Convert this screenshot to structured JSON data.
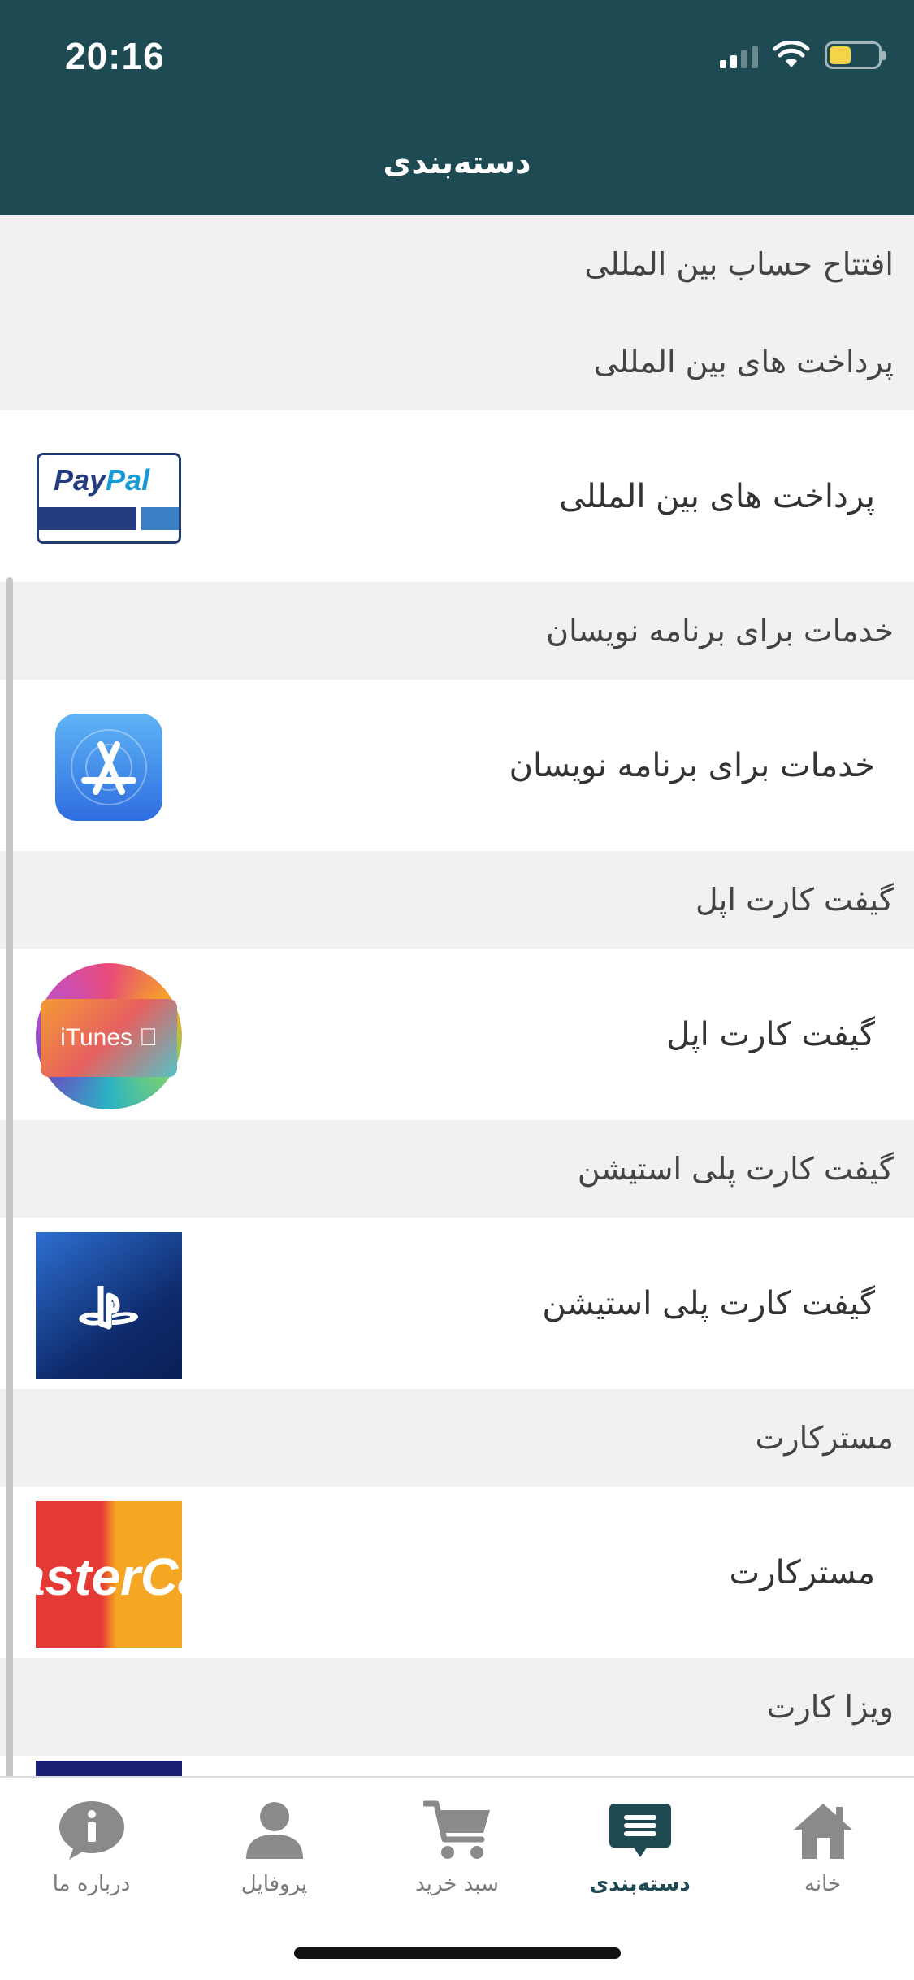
{
  "status_bar": {
    "time": "20:16",
    "battery_level": 0.45
  },
  "header": {
    "title": "دسته‌بندی"
  },
  "list": [
    {
      "type": "section",
      "title": "افتتاح حساب بین المللی"
    },
    {
      "type": "section",
      "title": "پرداخت های بین المللی"
    },
    {
      "type": "item",
      "label": "پرداخت های بین المللی",
      "icon": "paypal-logo"
    },
    {
      "type": "section",
      "title": "خدمات برای برنامه نویسان"
    },
    {
      "type": "item",
      "label": "خدمات برای برنامه نویسان",
      "icon": "app-store-icon"
    },
    {
      "type": "section",
      "title": "گیفت کارت اپل"
    },
    {
      "type": "item",
      "label": "گیفت کارت اپل",
      "icon": "itunes-logo"
    },
    {
      "type": "section",
      "title": "گیفت کارت پلی استیشن"
    },
    {
      "type": "item",
      "label": "گیفت کارت پلی استیشن",
      "icon": "playstation-logo"
    },
    {
      "type": "section",
      "title": "مسترکارت"
    },
    {
      "type": "item",
      "label": "مسترکارت",
      "icon": "mastercard-logo"
    },
    {
      "type": "section",
      "title": "ویزا کارت"
    }
  ],
  "logos": {
    "paypal_text_1": "Pay",
    "paypal_text_2": "Pal",
    "itunes_text": "iTunes",
    "mastercard_text": "asterCa"
  },
  "tabs": [
    {
      "label": "درباره ما",
      "icon": "info-icon",
      "active": false
    },
    {
      "label": "پروفایل",
      "icon": "user-icon",
      "active": false
    },
    {
      "label": "سبد خرید",
      "icon": "cart-icon",
      "active": false
    },
    {
      "label": "دسته‌بندی",
      "icon": "menu-icon",
      "active": true
    },
    {
      "label": "خانه",
      "icon": "home-icon",
      "active": false
    }
  ],
  "colors": {
    "header_bg": "#1e4a53",
    "section_bg": "#f1f1f1",
    "active_tab": "#1e4a53",
    "inactive_tab": "#8a8a8a"
  }
}
